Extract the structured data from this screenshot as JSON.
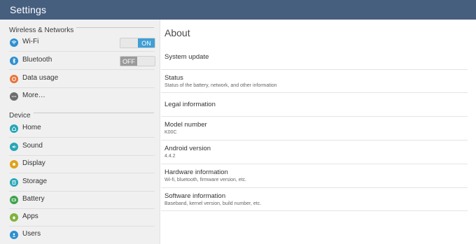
{
  "window": {
    "title": "Settings"
  },
  "sidebar": {
    "sections": [
      {
        "header": "Wireless & Networks"
      },
      {
        "header": "Device"
      }
    ],
    "items": [
      {
        "label": "Wi-Fi",
        "icon": "wifi-icon",
        "color": "#2f8fd0",
        "toggle": "ON",
        "toggle_state": "on"
      },
      {
        "label": "Bluetooth",
        "icon": "bluetooth-icon",
        "color": "#2f8fd0",
        "toggle": "OFF",
        "toggle_state": "off"
      },
      {
        "label": "Data usage",
        "icon": "data-usage-icon",
        "color": "#e8743b"
      },
      {
        "label": "More…",
        "icon": "more-icon",
        "color": "#6d6d6d"
      },
      {
        "label": "Home",
        "icon": "home-icon",
        "color": "#26a6b8"
      },
      {
        "label": "Sound",
        "icon": "sound-icon",
        "color": "#26a6b8"
      },
      {
        "label": "Display",
        "icon": "display-icon",
        "color": "#e0a21a"
      },
      {
        "label": "Storage",
        "icon": "storage-icon",
        "color": "#26a6b8"
      },
      {
        "label": "Battery",
        "icon": "battery-icon",
        "color": "#3fa34d"
      },
      {
        "label": "Apps",
        "icon": "apps-icon",
        "color": "#7fb33a"
      },
      {
        "label": "Users",
        "icon": "users-icon",
        "color": "#2f8fd0"
      }
    ]
  },
  "main": {
    "title": "About",
    "rows": [
      {
        "title": "System update",
        "subtitle": ""
      },
      {
        "title": "Status",
        "subtitle": "Status of the battery, network, and other information"
      },
      {
        "title": "Legal information",
        "subtitle": ""
      },
      {
        "title": "Model number",
        "subtitle": "K00C"
      },
      {
        "title": "Android version",
        "subtitle": "4.4.2"
      },
      {
        "title": "Hardware information",
        "subtitle": "Wi-fi, bluetooth, firmware version, etc."
      },
      {
        "title": "Software information",
        "subtitle": "Baseband, kernel version, build number, etc."
      }
    ]
  }
}
